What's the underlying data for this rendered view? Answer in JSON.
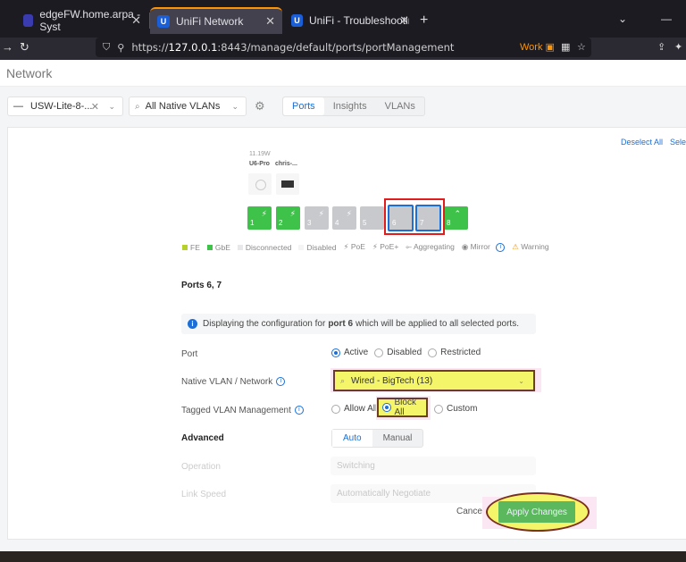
{
  "browser": {
    "tabs": [
      {
        "title": "edgeFW.home.arpa - Syst",
        "active": false
      },
      {
        "title": "UniFi Network",
        "active": true
      },
      {
        "title": "UniFi - Troubleshooting U",
        "active": false
      }
    ],
    "new_tab": "+",
    "url_host": "127.0.0.1",
    "url_prefix": "https://",
    "url_rest": ":8443/manage/default/ports/portManagement",
    "container": "Work"
  },
  "app": {
    "title": "Network",
    "device_select": "USW-Lite-8-...",
    "vlan_filter": "All Native VLANs",
    "view_tabs": [
      "Ports",
      "Insights",
      "VLANs"
    ],
    "active_view": "Ports",
    "deselect_all": "Deselect All",
    "select_all": "Select All"
  },
  "switch": {
    "poe_watt": "11.19W",
    "devices": [
      {
        "label": "U6-Pro",
        "icon": "access-point-icon"
      },
      {
        "label": "chris-...",
        "icon": "switch-device-icon"
      }
    ],
    "ports": [
      {
        "n": "1",
        "state": "gbe",
        "poe": true
      },
      {
        "n": "2",
        "state": "gbe",
        "poe": true
      },
      {
        "n": "3",
        "state": "disc",
        "poe": true
      },
      {
        "n": "4",
        "state": "disc",
        "poe": true
      },
      {
        "n": "5",
        "state": "disc",
        "poe": false
      },
      {
        "n": "6",
        "state": "sel",
        "poe": false
      },
      {
        "n": "7",
        "state": "sel",
        "poe": false
      },
      {
        "n": "8",
        "state": "gbe",
        "poe": false,
        "uplink": true
      }
    ],
    "legend": {
      "fe": "FE",
      "gbe": "GbE",
      "disconnected": "Disconnected",
      "disabled": "Disabled",
      "poe": "PoE",
      "poe_plus": "PoE+",
      "aggregating": "Aggregating",
      "mirror": "Mirror",
      "warning": "Warning"
    },
    "colors": {
      "fe": "#b7d12a",
      "gbe": "#3ec24a",
      "selected": "#1a6fd8",
      "highlight": "#e01c1c"
    }
  },
  "config": {
    "title": "Ports 6, 7",
    "banner_prefix": "Displaying the configuration for",
    "banner_port": "port 6",
    "banner_suffix": "which will be applied to all selected ports.",
    "port_label": "Port",
    "port_options": [
      "Active",
      "Disabled",
      "Restricted"
    ],
    "native_vlan_label": "Native VLAN / Network",
    "native_vlan_value": "Wired - BigTech (13)",
    "tagged_label": "Tagged VLAN Management",
    "tagged_options": [
      "Allow All",
      "Block All",
      "Custom"
    ],
    "advanced_label": "Advanced",
    "advanced_options": [
      "Auto",
      "Manual"
    ],
    "operation_label": "Operation",
    "operation_value": "Switching",
    "link_speed_label": "Link Speed",
    "link_speed_value": "Automatically Negotiate",
    "cancel": "Cancel",
    "apply": "Apply Changes"
  }
}
